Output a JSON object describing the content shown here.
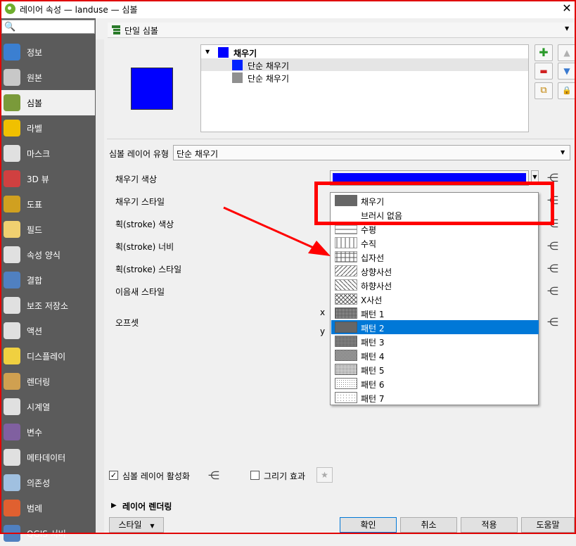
{
  "window": {
    "title": "레이어 속성 — landuse — 심볼",
    "close": "✕"
  },
  "sidebar": {
    "search_icon": "🔍",
    "items": [
      {
        "label": "정보",
        "icon": "info-icon",
        "color": "#3b7fd1"
      },
      {
        "label": "원본",
        "icon": "gear-wrench-icon",
        "color": "#c8c8c8"
      },
      {
        "label": "심볼",
        "icon": "paintbrush-icon",
        "color": "#7a9a3a"
      },
      {
        "label": "라벨",
        "icon": "abc-label-icon",
        "color": "#f0c000"
      },
      {
        "label": "마스크",
        "icon": "abc-mask-icon",
        "color": "#e0e0e0"
      },
      {
        "label": "3D 뷰",
        "icon": "cube-icon",
        "color": "#d04040"
      },
      {
        "label": "도표",
        "icon": "diagram-icon",
        "color": "#d0a020"
      },
      {
        "label": "필드",
        "icon": "fields-icon",
        "color": "#f0d070"
      },
      {
        "label": "속성 양식",
        "icon": "form-icon",
        "color": "#e0e0e0"
      },
      {
        "label": "결합",
        "icon": "join-icon",
        "color": "#5080c0"
      },
      {
        "label": "보조 저장소",
        "icon": "storage-icon",
        "color": "#e0e0e0"
      },
      {
        "label": "액션",
        "icon": "action-gear-icon",
        "color": "#e0e0e0"
      },
      {
        "label": "디스플레이",
        "icon": "speech-bubble-icon",
        "color": "#f0d040"
      },
      {
        "label": "렌더링",
        "icon": "paintbrush-render-icon",
        "color": "#d0a050"
      },
      {
        "label": "시계열",
        "icon": "clock-icon",
        "color": "#e0e0e0"
      },
      {
        "label": "변수",
        "icon": "variable-icon",
        "color": "#8060a0"
      },
      {
        "label": "메타데이터",
        "icon": "metadata-icon",
        "color": "#e0e0e0"
      },
      {
        "label": "의존성",
        "icon": "dependency-icon",
        "color": "#a0c0e0"
      },
      {
        "label": "범례",
        "icon": "legend-icon",
        "color": "#e06030"
      },
      {
        "label": "QGIS 서버",
        "icon": "server-icon",
        "color": "#5080c0"
      }
    ]
  },
  "renderer": {
    "label": "단일 심볼"
  },
  "symbol_tree": {
    "root": "채우기",
    "children": [
      "단순 채우기",
      "단순 채우기"
    ],
    "colors": [
      "#0000ff",
      "#0022ff",
      "#909090"
    ]
  },
  "side_buttons": {
    "add": "✚",
    "remove": "▬",
    "duplicate": "⧉",
    "lock": "🔒",
    "up": "▲",
    "down": "▼"
  },
  "layer_type": {
    "label": "심볼 레이어 유형",
    "value": "단순 채우기"
  },
  "properties": [
    "채우기 색상",
    "채우기 스타일",
    "획(stroke) 색상",
    "획(stroke) 너비",
    "획(stroke) 스타일",
    "이음새 스타일",
    "오프셋"
  ],
  "offset_axes": [
    "x",
    "y"
  ],
  "fill_color": "#0000ff",
  "fill_style_dropdown": {
    "items": [
      {
        "label": "채우기",
        "pattern": "solid"
      },
      {
        "label": "브러시 없음",
        "pattern": "none"
      },
      {
        "label": "수평",
        "pattern": "horizontal"
      },
      {
        "label": "수직",
        "pattern": "vertical"
      },
      {
        "label": "십자선",
        "pattern": "cross"
      },
      {
        "label": "상향사선",
        "pattern": "bdiag"
      },
      {
        "label": "하향사선",
        "pattern": "fdiag"
      },
      {
        "label": "X사선",
        "pattern": "diagcross"
      },
      {
        "label": "패턴 1",
        "pattern": "dense1"
      },
      {
        "label": "패턴 2",
        "pattern": "dense2"
      },
      {
        "label": "패턴 3",
        "pattern": "dense3"
      },
      {
        "label": "패턴 4",
        "pattern": "dense4"
      },
      {
        "label": "패턴 5",
        "pattern": "dense5"
      },
      {
        "label": "패턴 6",
        "pattern": "dense6"
      },
      {
        "label": "패턴 7",
        "pattern": "dense7"
      }
    ],
    "selected_index": 9
  },
  "enable_layer": {
    "label": "심볼 레이어 활성화",
    "checked": "✓"
  },
  "draw_effects": {
    "label": "그리기 효과"
  },
  "layer_rendering": {
    "label": "레이어 렌더링",
    "arrow": "▶"
  },
  "buttons": {
    "style": "스타일",
    "ok": "확인",
    "cancel": "취소",
    "apply": "적용",
    "help": "도움말"
  },
  "annotation_color": "#ff0000"
}
